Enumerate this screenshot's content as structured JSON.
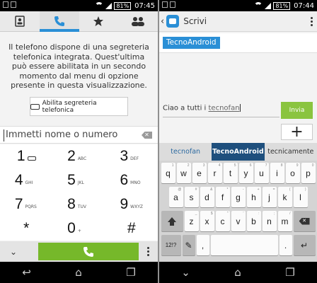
{
  "left": {
    "status": {
      "battery": "81%",
      "time": "07:45"
    },
    "tabs": [
      {
        "name": "contacts",
        "icon": "contact-card-icon"
      },
      {
        "name": "phone",
        "icon": "phone-icon",
        "active": true
      },
      {
        "name": "favorites",
        "icon": "star-icon"
      },
      {
        "name": "groups",
        "icon": "people-icon"
      }
    ],
    "voicemail_text": "Il telefono dispone di una segreteria telefonica integrata. Quest'ultima può essere abilitata in un secondo momento dal menu di opzione presente in questa visualizzazione.",
    "voicemail_button": "Abilita segreteria telefonica",
    "number_placeholder": "Immetti nome o numero",
    "keys": [
      {
        "num": "1",
        "letters": ""
      },
      {
        "num": "2",
        "letters": "ABC"
      },
      {
        "num": "3",
        "letters": "DEF"
      },
      {
        "num": "4",
        "letters": "GHI"
      },
      {
        "num": "5",
        "letters": "JKL"
      },
      {
        "num": "6",
        "letters": "MNO"
      },
      {
        "num": "7",
        "letters": "PQRS"
      },
      {
        "num": "8",
        "letters": "TUV"
      },
      {
        "num": "9",
        "letters": "WXYZ"
      },
      {
        "num": "*",
        "letters": ""
      },
      {
        "num": "0",
        "letters": "+"
      },
      {
        "num": "#",
        "letters": ""
      }
    ]
  },
  "right": {
    "status": {
      "battery": "81%",
      "time": "07:44"
    },
    "title": "Scrivi",
    "recipient_chip": "TecnoAndroid",
    "recipient_suffix": ",",
    "message_text": "Ciao a tutti i ",
    "message_underlined": "tecnofan",
    "send_label": "Invia",
    "plus_label": "+",
    "suggestions": [
      "tecnofan",
      "TecnoAndroid",
      "tecnicamente"
    ],
    "selected_suggestion": "TecnoAndroid",
    "kb_rows": [
      [
        {
          "k": "q",
          "h": "1"
        },
        {
          "k": "w",
          "h": "2"
        },
        {
          "k": "e",
          "h": "3"
        },
        {
          "k": "r",
          "h": "4"
        },
        {
          "k": "t",
          "h": "5"
        },
        {
          "k": "y",
          "h": "6"
        },
        {
          "k": "u",
          "h": "7"
        },
        {
          "k": "i",
          "h": "8"
        },
        {
          "k": "o",
          "h": "9"
        },
        {
          "k": "p",
          "h": "0"
        }
      ],
      [
        {
          "k": "a",
          "h": "@"
        },
        {
          "k": "s",
          "h": "#"
        },
        {
          "k": "d",
          "h": "&"
        },
        {
          "k": "f",
          "h": "*"
        },
        {
          "k": "g",
          "h": "-"
        },
        {
          "k": "h",
          "h": "+"
        },
        {
          "k": "j",
          "h": "="
        },
        {
          "k": "k",
          "h": "("
        },
        {
          "k": "l",
          "h": ")"
        }
      ],
      [
        {
          "k": "z",
          "h": "_"
        },
        {
          "k": "x",
          "h": "$"
        },
        {
          "k": "c",
          "h": "\""
        },
        {
          "k": "v",
          "h": "'"
        },
        {
          "k": "b",
          "h": ":"
        },
        {
          "k": "n",
          "h": ";"
        },
        {
          "k": "m",
          "h": "/"
        }
      ]
    ],
    "bottom_row": {
      "num_label": "12!?",
      "dot": ".",
      "comma": ","
    }
  }
}
